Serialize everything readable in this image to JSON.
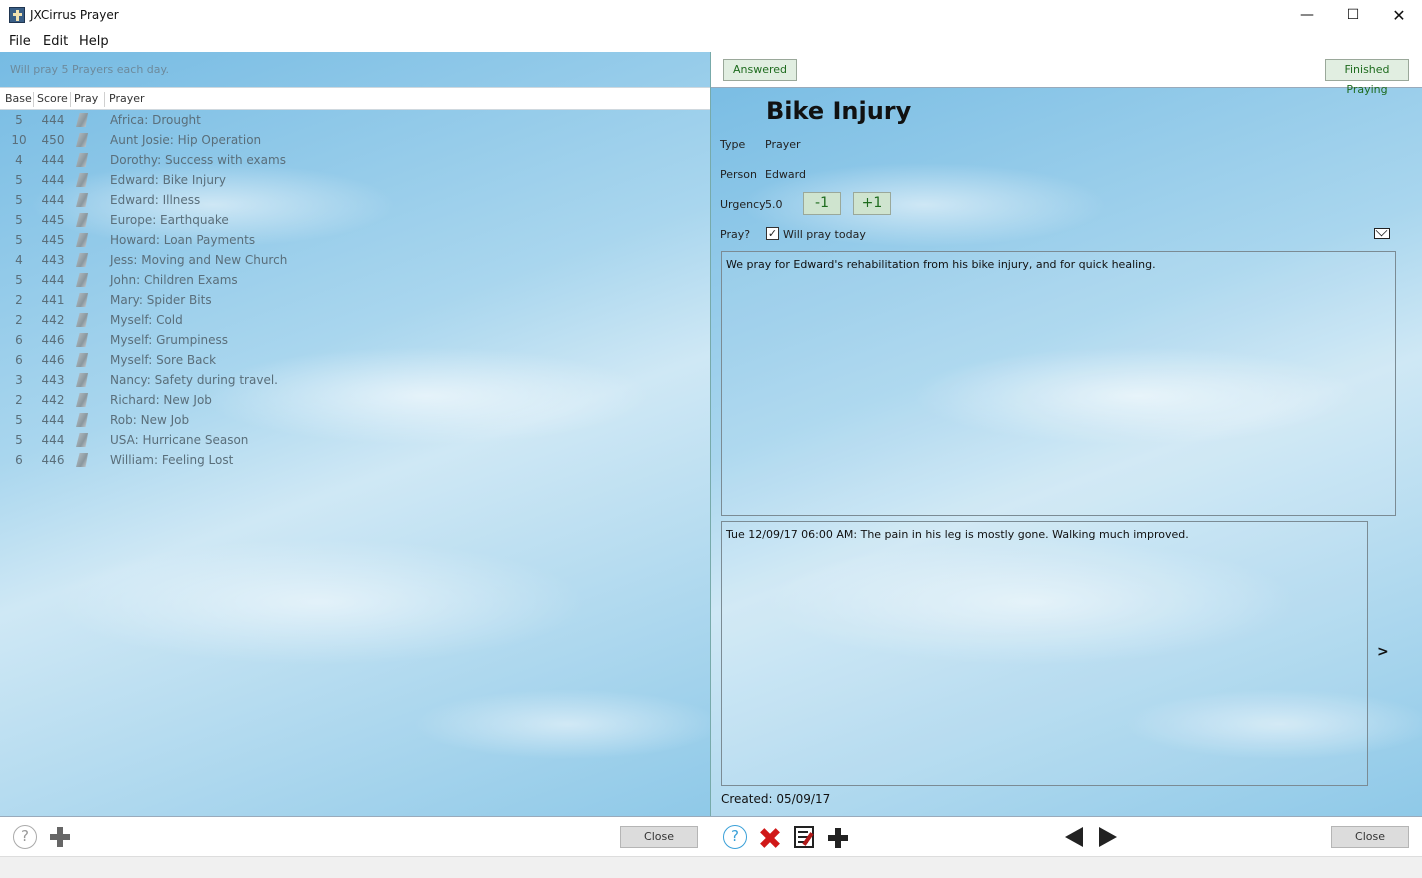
{
  "window": {
    "title": "JXCirrus Prayer",
    "minimize": "—",
    "maximize": "☐",
    "close": "✕"
  },
  "menu": [
    "File",
    "Edit",
    "Help"
  ],
  "left": {
    "status": "Will pray 5 Prayers each day.",
    "columns": [
      "Base",
      "Score",
      "Pray",
      "Prayer"
    ],
    "rows": [
      {
        "base": "5",
        "score": "444",
        "prayer": "Africa: Drought"
      },
      {
        "base": "10",
        "score": "450",
        "prayer": "Aunt Josie: Hip Operation"
      },
      {
        "base": "4",
        "score": "444",
        "prayer": "Dorothy: Success with exams"
      },
      {
        "base": "5",
        "score": "444",
        "prayer": "Edward: Bike Injury"
      },
      {
        "base": "5",
        "score": "444",
        "prayer": "Edward: Illness"
      },
      {
        "base": "5",
        "score": "445",
        "prayer": "Europe: Earthquake"
      },
      {
        "base": "5",
        "score": "445",
        "prayer": "Howard: Loan Payments"
      },
      {
        "base": "4",
        "score": "443",
        "prayer": "Jess: Moving and New Church"
      },
      {
        "base": "5",
        "score": "444",
        "prayer": "John: Children Exams"
      },
      {
        "base": "2",
        "score": "441",
        "prayer": "Mary: Spider Bits"
      },
      {
        "base": "2",
        "score": "442",
        "prayer": "Myself: Cold"
      },
      {
        "base": "6",
        "score": "446",
        "prayer": "Myself: Grumpiness"
      },
      {
        "base": "6",
        "score": "446",
        "prayer": "Myself: Sore Back"
      },
      {
        "base": "3",
        "score": "443",
        "prayer": "Nancy: Safety during travel."
      },
      {
        "base": "2",
        "score": "442",
        "prayer": "Richard: New Job"
      },
      {
        "base": "5",
        "score": "444",
        "prayer": "Rob: New Job"
      },
      {
        "base": "5",
        "score": "444",
        "prayer": "USA: Hurricane Season"
      },
      {
        "base": "6",
        "score": "446",
        "prayer": "William: Feeling Lost"
      }
    ],
    "help_glyph": "?",
    "close_label": "Close"
  },
  "right": {
    "answered_label": "Answered",
    "finished_label": "Finished Praying",
    "title": "Bike Injury",
    "type_label": "Type",
    "type_value": "Prayer",
    "person_label": "Person",
    "person_value": "Edward",
    "urgency_label": "Urgency",
    "urgency_value": "5.0",
    "minus_label": "-1",
    "plus_label": "+1",
    "pray_label": "Pray?",
    "pray_checked": "✓",
    "pray_checkbox_label": "Will pray today",
    "description": "We pray for Edward's rehabilitation from his bike injury, and for quick healing.",
    "note": "Tue 12/09/17 06:00 AM: The pain in his leg is mostly gone.  Walking much improved.",
    "next_note": ">",
    "created": "Created: 05/09/17",
    "help_glyph": "?",
    "close_label": "Close"
  },
  "colors": {
    "sky": "#8cc7e6",
    "button_green_text": "#1e6b1e",
    "delete_red": "#d01818",
    "help_blue": "#3aa0d8"
  },
  "icons": [
    "app-icon",
    "help-icon",
    "add-icon",
    "delete-icon",
    "edit-icon",
    "previous-icon",
    "next-icon",
    "mail-icon",
    "pray-icon"
  ]
}
